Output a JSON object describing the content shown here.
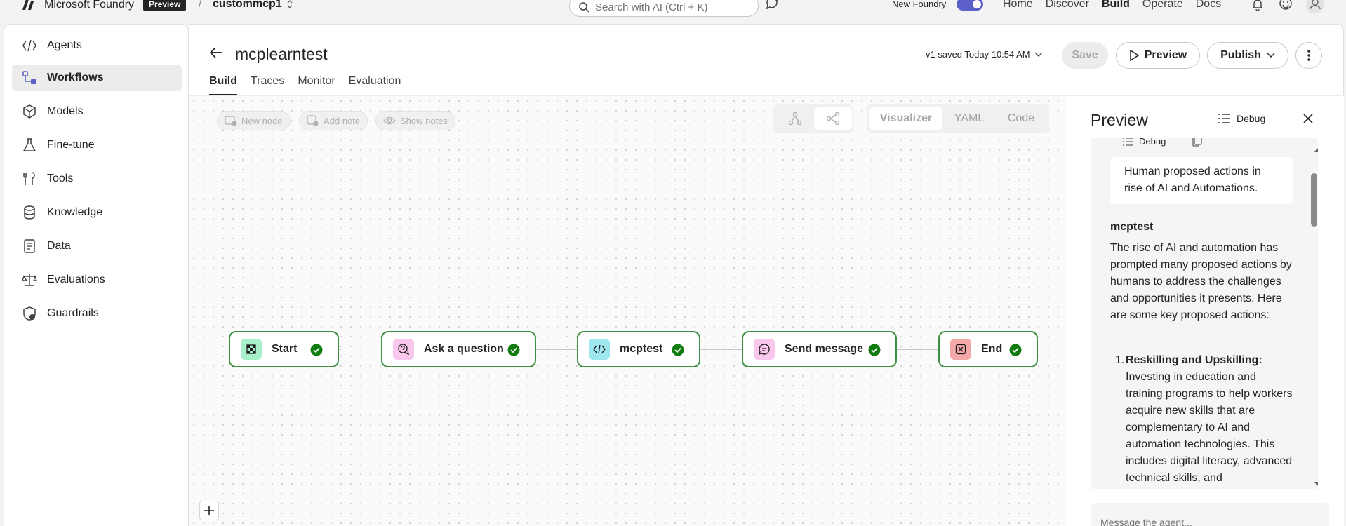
{
  "topbar": {
    "brand": "Microsoft Foundry",
    "badge": "Preview",
    "separator": "/",
    "project": "custommcp1",
    "search_placeholder": "Search with AI (Ctrl + K)",
    "new_foundry_label": "New Foundry",
    "new_foundry_on": true,
    "nav": [
      {
        "label": "Home",
        "active": false
      },
      {
        "label": "Discover",
        "active": false
      },
      {
        "label": "Build",
        "active": true
      },
      {
        "label": "Operate",
        "active": false
      },
      {
        "label": "Docs",
        "active": false
      }
    ],
    "icons": [
      "bell-icon",
      "smiley-icon",
      "avatar-icon"
    ]
  },
  "sidebar": {
    "items": [
      {
        "label": "Agents",
        "icon": "agents-icon",
        "selected": false
      },
      {
        "label": "Workflows",
        "icon": "workflows-icon",
        "selected": true
      },
      {
        "label": "Models",
        "icon": "models-icon",
        "selected": false
      },
      {
        "label": "Fine-tune",
        "icon": "flask-icon",
        "selected": false
      },
      {
        "label": "Tools",
        "icon": "tools-icon",
        "selected": false
      },
      {
        "label": "Knowledge",
        "icon": "database-icon",
        "selected": false
      },
      {
        "label": "Data",
        "icon": "document-icon",
        "selected": false
      },
      {
        "label": "Evaluations",
        "icon": "scale-icon",
        "selected": false
      },
      {
        "label": "Guardrails",
        "icon": "shield-icon",
        "selected": false
      }
    ]
  },
  "workflow": {
    "title": "mcplearntest",
    "tabs": [
      {
        "label": "Build",
        "active": true
      },
      {
        "label": "Traces",
        "active": false
      },
      {
        "label": "Monitor",
        "active": false
      },
      {
        "label": "Evaluation",
        "active": false
      }
    ],
    "saved_status": "v1 saved Today 10:54 AM",
    "save_label": "Save",
    "preview_label": "Preview",
    "publish_label": "Publish"
  },
  "canvas": {
    "tools": {
      "new_node": "New node",
      "add_note": "Add note",
      "show_notes": "Show notes"
    },
    "modes": [
      {
        "label": "Visualizer",
        "active": true
      },
      {
        "label": "YAML",
        "active": false
      },
      {
        "label": "Code",
        "active": false
      }
    ],
    "nodes": [
      {
        "label": "Start",
        "icon": "start-icon",
        "icon_bg": "#a7f0c9",
        "status": "success"
      },
      {
        "label": "Ask a question",
        "icon": "ask-question-icon",
        "icon_bg": "#f9c6ec",
        "status": "success"
      },
      {
        "label": "mcptest",
        "icon": "code-icon",
        "icon_bg": "#9fe7ef",
        "status": "success"
      },
      {
        "label": "Send message",
        "icon": "message-icon",
        "icon_bg": "#f9c6ec",
        "status": "success"
      },
      {
        "label": "End",
        "icon": "end-icon",
        "icon_bg": "#f4a9a9",
        "status": "success"
      }
    ],
    "colors": {
      "success": "#107c10",
      "node_border": "#3f9142"
    }
  },
  "preview": {
    "title": "Preview",
    "debug_label": "Debug",
    "mini_debug_label": "Debug",
    "user_message": "Human proposed actions in rise of AI and Automations.",
    "agent_name": "mcptest",
    "response_intro": "The rise of AI and automation has prompted many proposed actions by humans to address the challenges and opportunities it presents. Here are some key proposed actions:",
    "response_list": [
      {
        "number": "1.",
        "heading": "Reskilling and Upskilling:",
        "text": "Investing in education and training programs to help workers acquire new skills that are complementary to AI and automation technologies. This includes digital literacy, advanced technical skills, and"
      }
    ],
    "input_placeholder": "Message the agent..."
  },
  "accent_color": "#5b5fc7"
}
